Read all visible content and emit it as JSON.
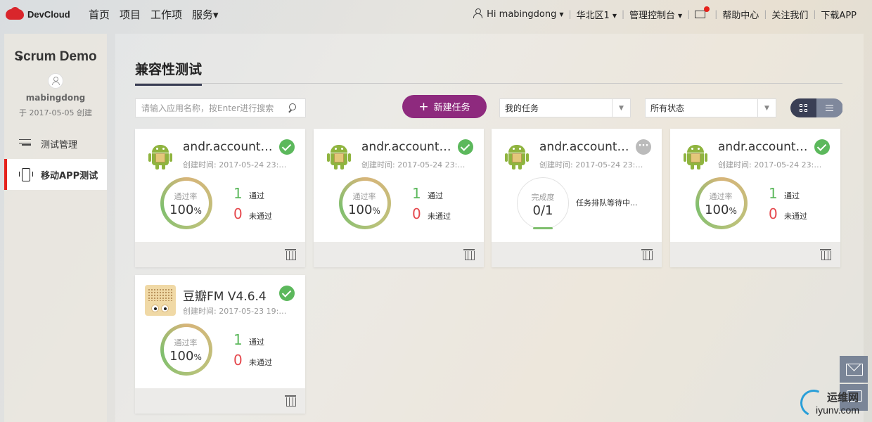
{
  "brand": {
    "name": "DevCloud",
    "color": "#d9262c"
  },
  "nav": {
    "items": [
      "首页",
      "项目",
      "工作项",
      "服务▾"
    ]
  },
  "top_right": {
    "user": "Hi mabingdong",
    "region": "华北区1",
    "console": "管理控制台",
    "help": "帮助中心",
    "follow": "关注我们",
    "download": "下载APP"
  },
  "sidebar": {
    "project_title": "Scrum Demo",
    "username": "mabingdong",
    "created": "于 2017-05-05 创建",
    "items": [
      {
        "label": "测试管理",
        "icon": "sliders-icon",
        "active": false
      },
      {
        "label": "移动APP测试",
        "icon": "phone-icon",
        "active": true
      }
    ]
  },
  "main": {
    "title": "兼容性测试",
    "search_placeholder": "请输入应用名称，按Enter进行搜索",
    "new_task": "新建任务",
    "filter_owner": "我的任务",
    "filter_status": "所有状态",
    "accent_color": "#8e2a7e"
  },
  "cards": [
    {
      "name": "andr.account ...",
      "time": "创建时间: 2017-05-24 23:0...",
      "status": "ok",
      "ring_label": "通过率",
      "ring_value": "100",
      "ring_unit": "%",
      "pass_count": "1",
      "pass_label": "通过",
      "fail_count": "0",
      "fail_label": "未通过"
    },
    {
      "name": "andr.account ...",
      "time": "创建时间: 2017-05-24 23:0...",
      "status": "ok",
      "ring_label": "通过率",
      "ring_value": "100",
      "ring_unit": "%",
      "pass_count": "1",
      "pass_label": "通过",
      "fail_count": "0",
      "fail_label": "未通过"
    },
    {
      "name": "andr.account ...",
      "time": "创建时间: 2017-05-24 23:0...",
      "status": "waiting",
      "ring_label": "完成度",
      "ring_value": "0/1",
      "waiting_text": "任务排队等待中..."
    },
    {
      "name": "andr.account ...",
      "time": "创建时间: 2017-05-24 23:0...",
      "status": "ok",
      "ring_label": "通过率",
      "ring_value": "100",
      "ring_unit": "%",
      "pass_count": "1",
      "pass_label": "通过",
      "fail_count": "0",
      "fail_label": "未通过"
    },
    {
      "name": "豆瓣FM V4.6.4",
      "time": "创建时间: 2017-05-23 19:3...",
      "status": "ok",
      "ring_label": "通过率",
      "ring_value": "100",
      "ring_unit": "%",
      "pass_count": "1",
      "pass_label": "通过",
      "fail_count": "0",
      "fail_label": "未通过"
    }
  ],
  "watermark": {
    "cn": "运维网",
    "en": "iyunv.com"
  }
}
